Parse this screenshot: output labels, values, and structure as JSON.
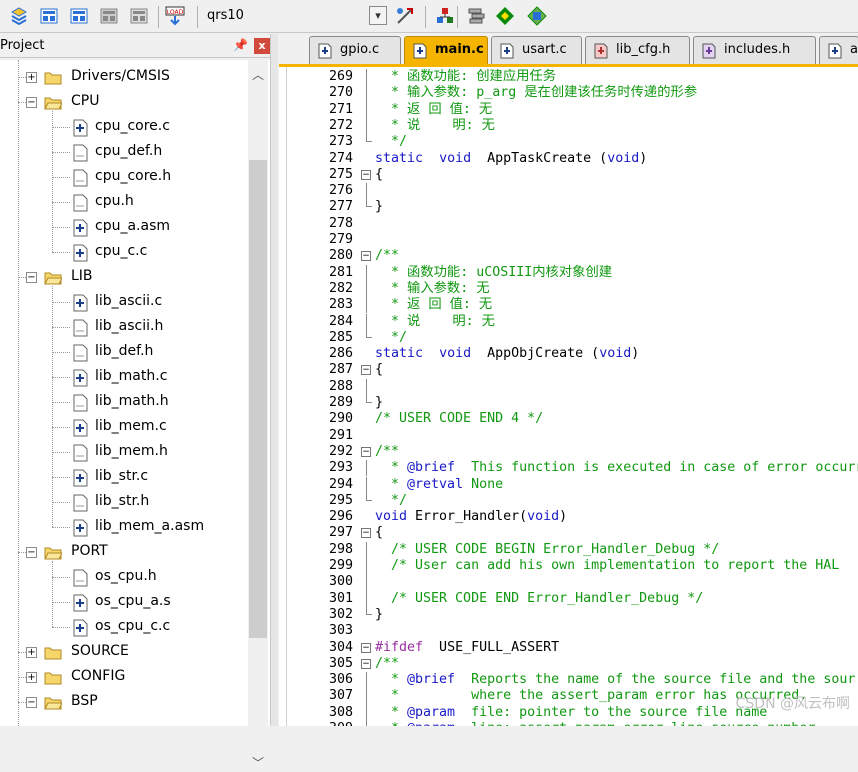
{
  "toolbar": {
    "target": "qrs10",
    "icons": [
      "translate-icon",
      "build-icon",
      "rebuild-icon",
      "batch-build-icon",
      "stop-build-icon",
      "download-icon",
      "target-options-icon",
      "manage-components-icon",
      "select-packs-icon",
      "pack-installer-icon",
      "options-icon"
    ]
  },
  "project": {
    "title": "Project",
    "pin": "ᵽ",
    "close": "x",
    "tree": [
      {
        "label": "Drivers/CMSIS",
        "type": "folder",
        "expanded": false,
        "level": 1
      },
      {
        "label": "CPU",
        "type": "folder",
        "expanded": true,
        "level": 1
      },
      {
        "label": "cpu_core.c",
        "type": "file",
        "plus": true,
        "level": 2
      },
      {
        "label": "cpu_def.h",
        "type": "file",
        "plus": false,
        "level": 2
      },
      {
        "label": "cpu_core.h",
        "type": "file",
        "plus": false,
        "level": 2
      },
      {
        "label": "cpu.h",
        "type": "file",
        "plus": false,
        "level": 2
      },
      {
        "label": "cpu_a.asm",
        "type": "file",
        "plus": true,
        "level": 2
      },
      {
        "label": "cpu_c.c",
        "type": "file",
        "plus": true,
        "level": 2
      },
      {
        "label": "LIB",
        "type": "folder",
        "expanded": true,
        "level": 1
      },
      {
        "label": "lib_ascii.c",
        "type": "file",
        "plus": true,
        "level": 2
      },
      {
        "label": "lib_ascii.h",
        "type": "file",
        "plus": false,
        "level": 2
      },
      {
        "label": "lib_def.h",
        "type": "file",
        "plus": false,
        "level": 2
      },
      {
        "label": "lib_math.c",
        "type": "file",
        "plus": true,
        "level": 2
      },
      {
        "label": "lib_math.h",
        "type": "file",
        "plus": false,
        "level": 2
      },
      {
        "label": "lib_mem.c",
        "type": "file",
        "plus": true,
        "level": 2
      },
      {
        "label": "lib_mem.h",
        "type": "file",
        "plus": false,
        "level": 2
      },
      {
        "label": "lib_str.c",
        "type": "file",
        "plus": true,
        "level": 2
      },
      {
        "label": "lib_str.h",
        "type": "file",
        "plus": false,
        "level": 2
      },
      {
        "label": "lib_mem_a.asm",
        "type": "file",
        "plus": true,
        "level": 2
      },
      {
        "label": "PORT",
        "type": "folder",
        "expanded": true,
        "level": 1
      },
      {
        "label": "os_cpu.h",
        "type": "file",
        "plus": false,
        "level": 2
      },
      {
        "label": "os_cpu_a.s",
        "type": "file",
        "plus": true,
        "level": 2
      },
      {
        "label": "os_cpu_c.c",
        "type": "file",
        "plus": true,
        "level": 2
      },
      {
        "label": "SOURCE",
        "type": "folder",
        "expanded": false,
        "level": 1
      },
      {
        "label": "CONFIG",
        "type": "folder",
        "expanded": false,
        "level": 1
      },
      {
        "label": "BSP",
        "type": "folder",
        "expanded": true,
        "level": 1
      }
    ]
  },
  "tabs": [
    {
      "label": "gpio.c",
      "kind": "c",
      "active": false
    },
    {
      "label": "main.c",
      "kind": "c",
      "active": true
    },
    {
      "label": "usart.c",
      "kind": "c",
      "active": false
    },
    {
      "label": "lib_cfg.h",
      "kind": "h-red",
      "active": false
    },
    {
      "label": "includes.h",
      "kind": "h-purple",
      "active": false
    },
    {
      "label": "a",
      "kind": "c",
      "active": false
    }
  ],
  "code": [
    {
      "n": "269",
      "f": "v",
      "t": [
        [
          "c",
          "  * 函数功能: 创建应用任务"
        ]
      ]
    },
    {
      "n": "270",
      "f": "v",
      "t": [
        [
          "c",
          "  * 输入参数: p_arg 是在创建该任务时传递的形参"
        ]
      ]
    },
    {
      "n": "271",
      "f": "v",
      "t": [
        [
          "c",
          "  * 返 回 值: 无"
        ]
      ]
    },
    {
      "n": "272",
      "f": "v",
      "t": [
        [
          "c",
          "  * 说    明: 无"
        ]
      ]
    },
    {
      "n": "273",
      "f": "e",
      "t": [
        [
          "c",
          "  */"
        ]
      ]
    },
    {
      "n": "274",
      "f": "",
      "t": [
        [
          "k",
          "static"
        ],
        [
          "n",
          "  "
        ],
        [
          "k",
          "void"
        ],
        [
          "n",
          "  AppTaskCreate ("
        ],
        [
          "k",
          "void"
        ],
        [
          "n",
          ")"
        ]
      ]
    },
    {
      "n": "275",
      "f": "m",
      "t": [
        [
          "n",
          "{"
        ]
      ]
    },
    {
      "n": "276",
      "f": "v",
      "t": []
    },
    {
      "n": "277",
      "f": "e",
      "t": [
        [
          "n",
          "}"
        ]
      ]
    },
    {
      "n": "278",
      "f": "",
      "t": []
    },
    {
      "n": "279",
      "f": "",
      "t": []
    },
    {
      "n": "280",
      "f": "m",
      "t": [
        [
          "c",
          "/**"
        ]
      ]
    },
    {
      "n": "281",
      "f": "v",
      "t": [
        [
          "c",
          "  * 函数功能: uCOSIII内核对象创建"
        ]
      ]
    },
    {
      "n": "282",
      "f": "v",
      "t": [
        [
          "c",
          "  * 输入参数: 无"
        ]
      ]
    },
    {
      "n": "283",
      "f": "v",
      "t": [
        [
          "c",
          "  * 返 回 值: 无"
        ]
      ]
    },
    {
      "n": "284",
      "f": "v",
      "t": [
        [
          "c",
          "  * 说    明: 无"
        ]
      ]
    },
    {
      "n": "285",
      "f": "e",
      "t": [
        [
          "c",
          "  */"
        ]
      ]
    },
    {
      "n": "286",
      "f": "",
      "t": [
        [
          "k",
          "static"
        ],
        [
          "n",
          "  "
        ],
        [
          "k",
          "void"
        ],
        [
          "n",
          "  AppObjCreate ("
        ],
        [
          "k",
          "void"
        ],
        [
          "n",
          ")"
        ]
      ]
    },
    {
      "n": "287",
      "f": "m",
      "t": [
        [
          "n",
          "{"
        ]
      ]
    },
    {
      "n": "288",
      "f": "v",
      "t": []
    },
    {
      "n": "289",
      "f": "e",
      "t": [
        [
          "n",
          "}"
        ]
      ]
    },
    {
      "n": "290",
      "f": "",
      "t": [
        [
          "c",
          "/* USER CODE END 4 */"
        ]
      ]
    },
    {
      "n": "291",
      "f": "",
      "t": []
    },
    {
      "n": "292",
      "f": "m",
      "t": [
        [
          "c",
          "/**"
        ]
      ]
    },
    {
      "n": "293",
      "f": "v",
      "t": [
        [
          "c",
          "  * "
        ],
        [
          "k",
          "@brief"
        ],
        [
          "c",
          "  This function is executed in case of error occurre"
        ]
      ]
    },
    {
      "n": "294",
      "f": "v",
      "t": [
        [
          "c",
          "  * "
        ],
        [
          "k",
          "@retval"
        ],
        [
          "c",
          " None"
        ]
      ]
    },
    {
      "n": "295",
      "f": "e",
      "t": [
        [
          "c",
          "  */"
        ]
      ]
    },
    {
      "n": "296",
      "f": "",
      "t": [
        [
          "k",
          "void"
        ],
        [
          "n",
          " Error_Handler("
        ],
        [
          "k",
          "void"
        ],
        [
          "n",
          ")"
        ]
      ]
    },
    {
      "n": "297",
      "f": "m",
      "t": [
        [
          "n",
          "{"
        ]
      ]
    },
    {
      "n": "298",
      "f": "v",
      "t": [
        [
          "c",
          "  /* USER CODE BEGIN Error_Handler_Debug */"
        ]
      ]
    },
    {
      "n": "299",
      "f": "v",
      "t": [
        [
          "c",
          "  /* User can add his own implementation to report the HAL"
        ]
      ]
    },
    {
      "n": "300",
      "f": "v",
      "t": []
    },
    {
      "n": "301",
      "f": "v",
      "t": [
        [
          "c",
          "  /* USER CODE END Error_Handler_Debug */"
        ]
      ]
    },
    {
      "n": "302",
      "f": "e",
      "t": [
        [
          "n",
          "}"
        ]
      ]
    },
    {
      "n": "303",
      "f": "",
      "t": []
    },
    {
      "n": "304",
      "f": "m",
      "t": [
        [
          "p",
          "#ifdef"
        ],
        [
          "n",
          "  USE_FULL_ASSERT"
        ]
      ]
    },
    {
      "n": "305",
      "f": "m",
      "t": [
        [
          "c",
          "/**"
        ]
      ]
    },
    {
      "n": "306",
      "f": "v",
      "t": [
        [
          "c",
          "  * "
        ],
        [
          "k",
          "@brief"
        ],
        [
          "c",
          "  Reports the name of the source file and the sour"
        ]
      ]
    },
    {
      "n": "307",
      "f": "v",
      "t": [
        [
          "c",
          "  *         where the assert_param error has occurred."
        ]
      ]
    },
    {
      "n": "308",
      "f": "v",
      "t": [
        [
          "c",
          "  * "
        ],
        [
          "k",
          "@param"
        ],
        [
          "c",
          "  file: pointer to the source file name"
        ]
      ]
    },
    {
      "n": "309",
      "f": "v",
      "t": [
        [
          "c",
          "  * "
        ],
        [
          "k",
          "@param"
        ],
        [
          "c",
          "  line: assert_param error line source number"
        ]
      ]
    }
  ],
  "watermark": "CSDN @风云布啊"
}
